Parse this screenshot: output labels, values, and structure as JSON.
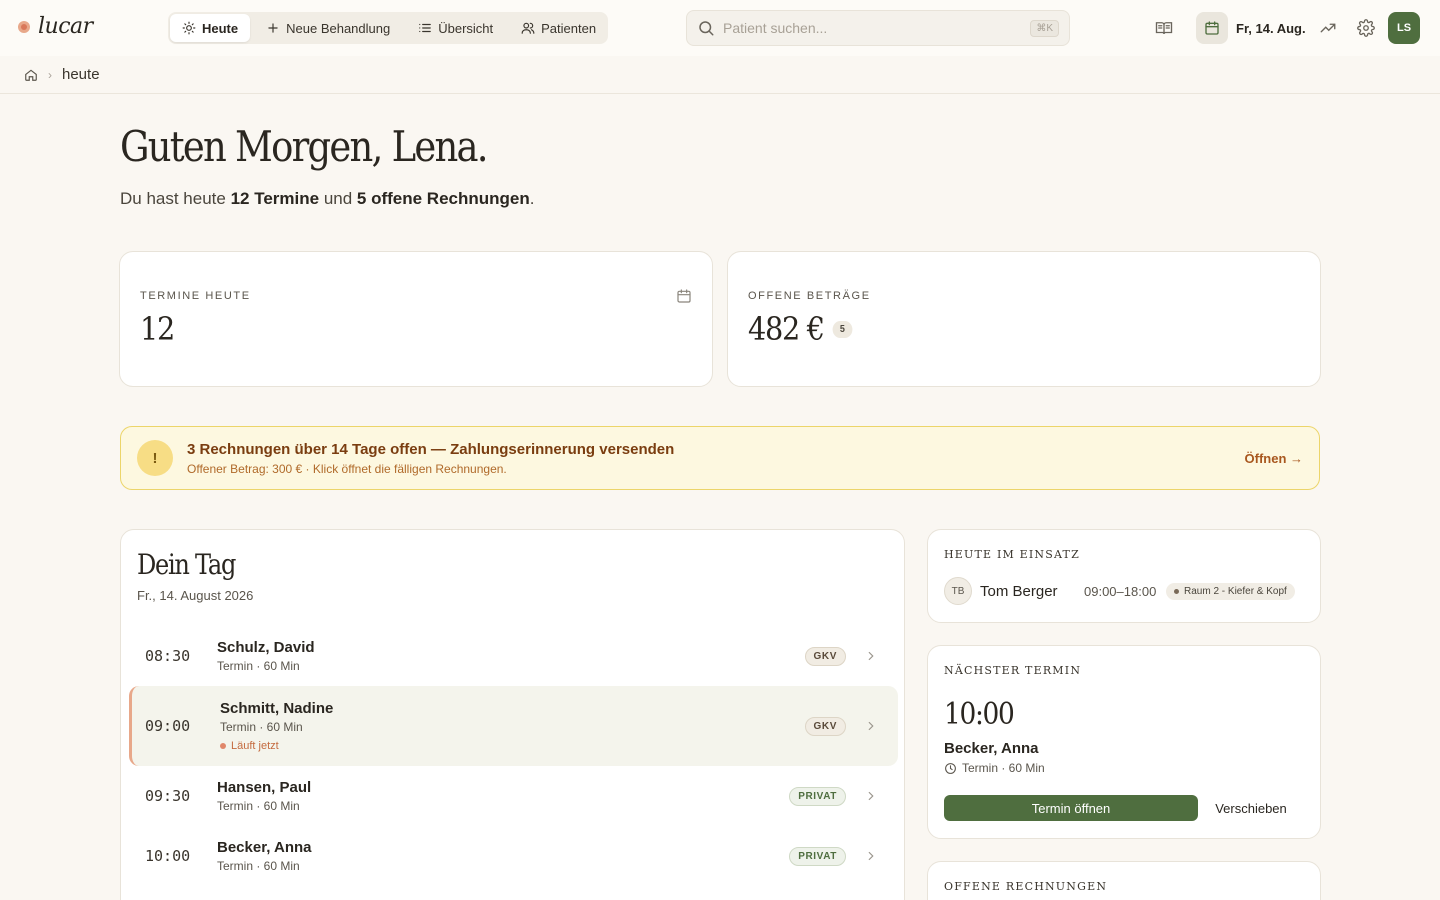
{
  "app": {
    "logo": "lucar"
  },
  "nav": {
    "items": [
      {
        "label": "Heute",
        "icon": "sun-icon",
        "active": true
      },
      {
        "label": "Neue Behandlung",
        "icon": "plus-icon",
        "active": false
      },
      {
        "label": "Übersicht",
        "icon": "list-icon",
        "active": false
      },
      {
        "label": "Patienten",
        "icon": "users-icon",
        "active": false
      }
    ]
  },
  "search": {
    "placeholder": "Patient suchen...",
    "shortcut": "⌘K"
  },
  "header": {
    "date": "Fr, 14. Aug.",
    "avatar_initials": "LS"
  },
  "breadcrumb": {
    "current": "heute"
  },
  "greeting": {
    "title": "Guten Morgen, Lena.",
    "prefix": "Du hast heute ",
    "appointments": "12 Termine",
    "middle": " und ",
    "invoices": "5 offene Rechnungen",
    "suffix": "."
  },
  "stats": {
    "appointments": {
      "label": "TERMINE HEUTE",
      "value": "12"
    },
    "open_amounts": {
      "label": "OFFENE BETRÄGE",
      "value": "482 €",
      "badge": "5"
    }
  },
  "alert": {
    "icon": "!",
    "title": "3 Rechnungen über 14 Tage offen — Zahlungserinnerung versenden",
    "subtitle": "Offener Betrag: 300 € · Klick öffnet die fälligen Rechnungen.",
    "action": "Öffnen →"
  },
  "day": {
    "title": "Dein Tag",
    "date": "Fr., 14. August 2026",
    "rows": [
      {
        "time": "08:30",
        "name": "Schulz, David",
        "meta": "Termin · 60 Min",
        "tag": "GKV"
      },
      {
        "time": "09:00",
        "name": "Schmitt, Nadine",
        "meta": "Termin · 60 Min",
        "tag": "GKV",
        "status": "Läuft jetzt"
      },
      {
        "time": "09:30",
        "name": "Hansen, Paul",
        "meta": "Termin · 60 Min",
        "tag": "PRIVAT"
      },
      {
        "time": "10:00",
        "name": "Becker, Anna",
        "meta": "Termin · 60 Min",
        "tag": "PRIVAT"
      }
    ]
  },
  "staff": {
    "label": "HEUTE IM EINSATZ",
    "initials": "TB",
    "name": "Tom Berger",
    "hours": "09:00–18:00",
    "room": "Raum 2 - Kiefer & Kopf"
  },
  "next": {
    "label": "NÄCHSTER TERMIN",
    "time": "10:00",
    "name": "Becker, Anna",
    "meta": "Termin · 60 Min",
    "primary": "Termin öffnen",
    "secondary": "Verschieben"
  },
  "invoices": {
    "label": "OFFENE RECHNUNGEN"
  },
  "colors": {
    "accent": "#4f6e3f",
    "warning_bg": "#fdf8e0",
    "live": "#e0876a"
  }
}
